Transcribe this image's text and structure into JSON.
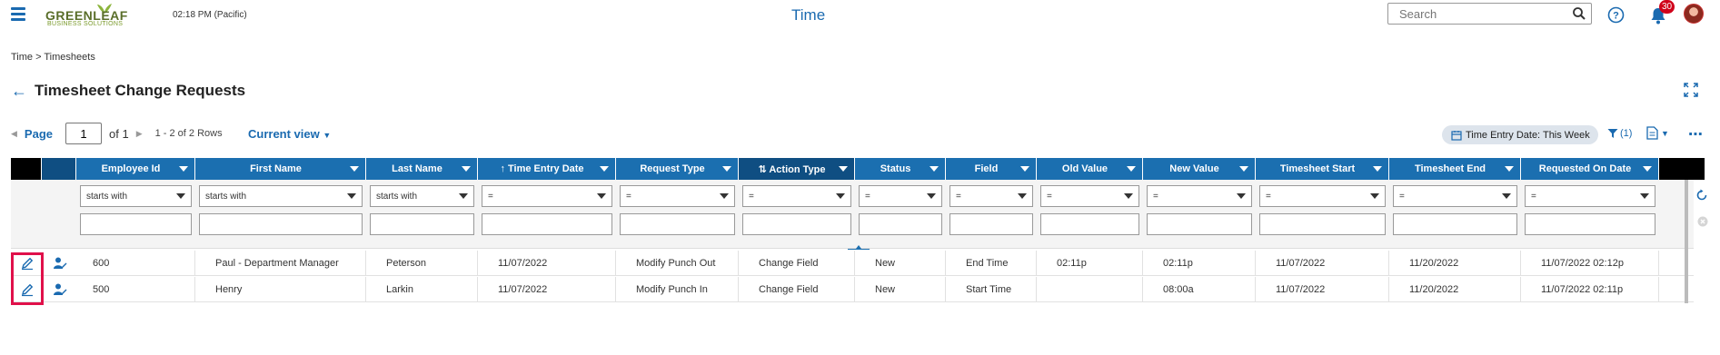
{
  "header": {
    "logo_line1": "GREENLEAF",
    "logo_line2": "BUSINESS SOLUTIONS",
    "clock": "02:18 PM (Pacific)",
    "app_title": "Time",
    "search_placeholder": "Search",
    "notification_count": "30"
  },
  "breadcrumb": "Time > Timesheets",
  "page_title": "Timesheet Change Requests",
  "pager": {
    "page_label": "Page",
    "page_value": "1",
    "of_label": "of 1",
    "rows_label": "1 - 2 of 2 Rows"
  },
  "current_view": "Current view",
  "filter_chip": "Time Entry Date: This Week",
  "filter_count": "(1)",
  "columns": [
    {
      "label": "Employee Id"
    },
    {
      "label": "First Name"
    },
    {
      "label": "Last Name"
    },
    {
      "label": "Time Entry Date",
      "sort": "↑"
    },
    {
      "label": "Request Type"
    },
    {
      "label": "Action Type",
      "sort": "⇅"
    },
    {
      "label": "Status"
    },
    {
      "label": "Field"
    },
    {
      "label": "Old Value"
    },
    {
      "label": "New Value"
    },
    {
      "label": "Timesheet Start"
    },
    {
      "label": "Timesheet End"
    },
    {
      "label": "Requested On Date"
    }
  ],
  "filter_ops": [
    "starts with",
    "starts with",
    "starts with",
    "=",
    "=",
    "=",
    "=",
    "=",
    "=",
    "=",
    "=",
    "=",
    "="
  ],
  "rows": [
    [
      "600",
      "Paul - Department Manager",
      "Peterson",
      "11/07/2022",
      "Modify Punch Out",
      "Change Field",
      "New",
      "End Time",
      "02:11p",
      "02:11p",
      "11/07/2022",
      "11/20/2022",
      "11/07/2022 02:12p"
    ],
    [
      "500",
      "Henry",
      "Larkin",
      "11/07/2022",
      "Modify Punch In",
      "Change Field",
      "New",
      "Start Time",
      "",
      "08:00a",
      "11/07/2022",
      "11/20/2022",
      "11/07/2022 02:11p"
    ]
  ],
  "colors": {
    "header_blue": "#1b6fb0",
    "sorted_header": "#0f4e82",
    "accent_blue": "#1a6ab0",
    "highlight_red": "#e0104a",
    "badge_red": "#d0021b"
  }
}
